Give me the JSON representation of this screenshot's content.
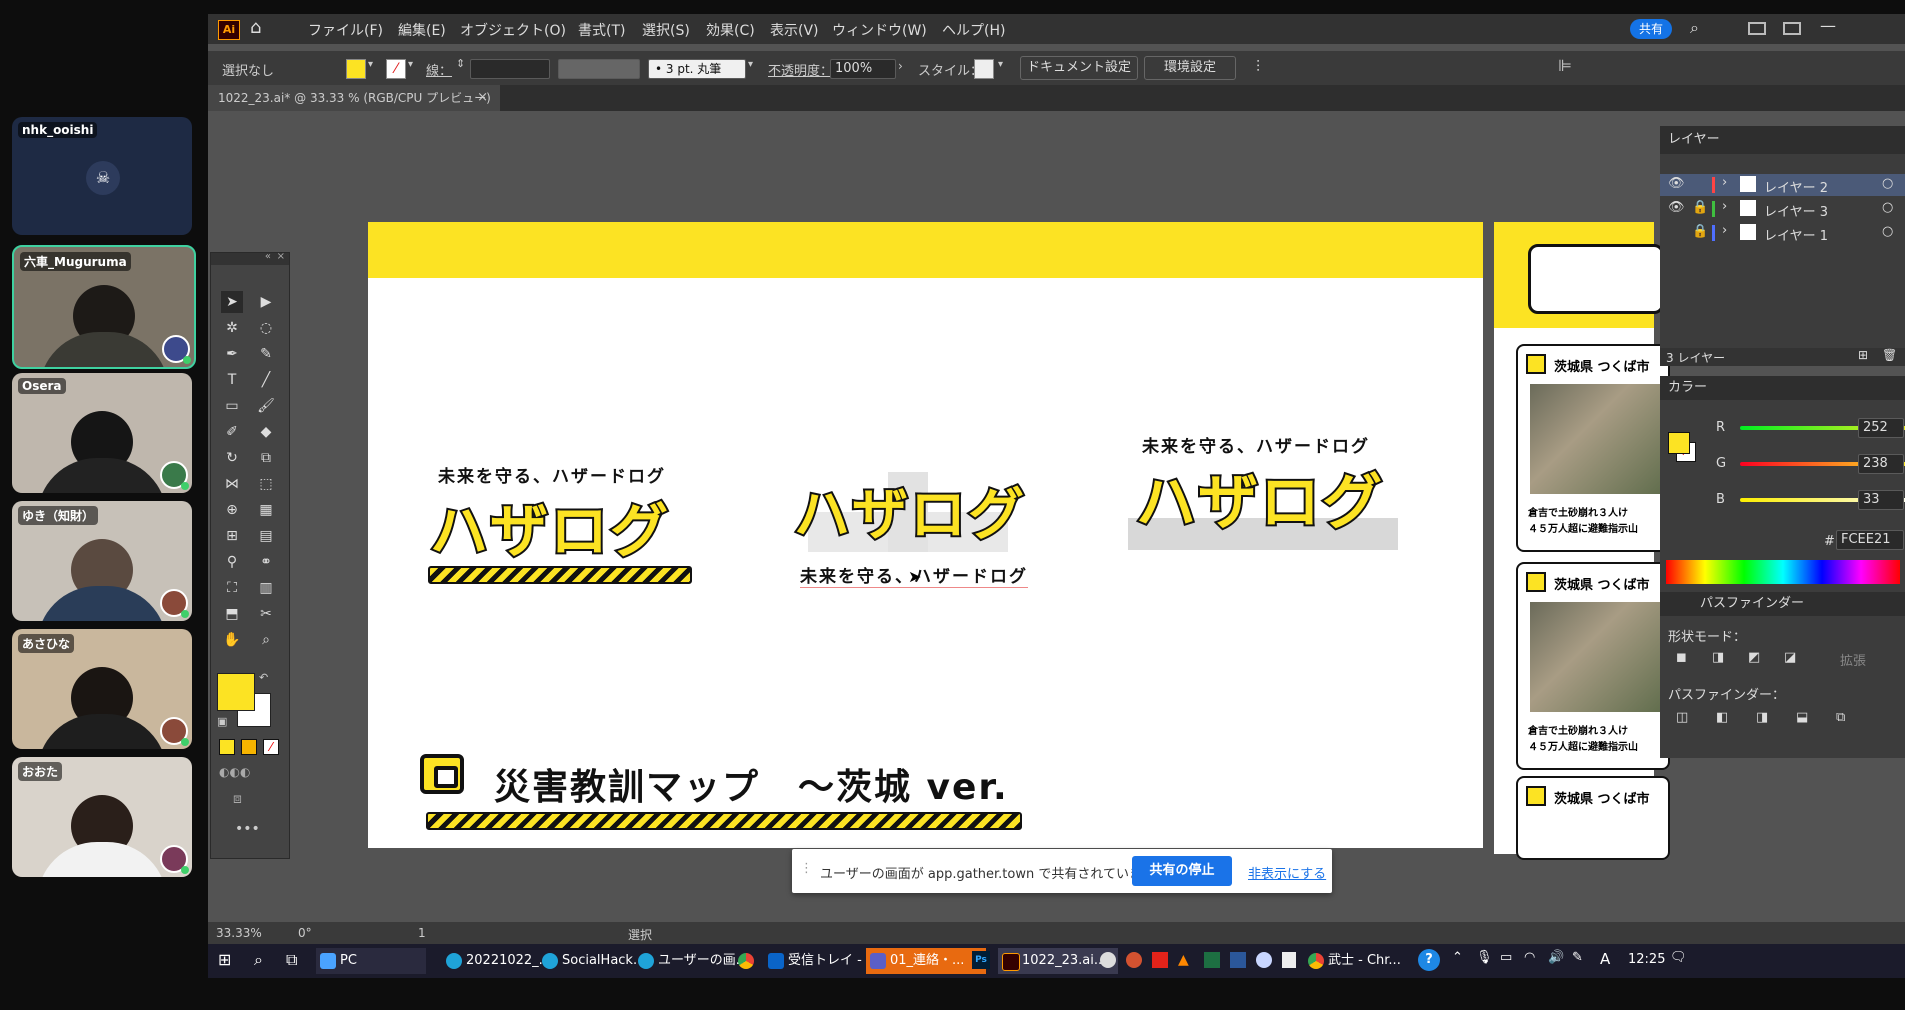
{
  "participants": [
    {
      "name": "nhk_ooishi",
      "camera_off": true
    },
    {
      "name": "六車_Muguruma"
    },
    {
      "name": "Osera"
    },
    {
      "name": "ゆき（知財）"
    },
    {
      "name": "あさひな"
    },
    {
      "name": "おおた"
    }
  ],
  "app": {
    "logo": "Ai",
    "menu": [
      "ファイル(F)",
      "編集(E)",
      "オブジェクト(O)",
      "書式(T)",
      "選択(S)",
      "効果(C)",
      "表示(V)",
      "ウィンドウ(W)",
      "ヘルプ(H)"
    ],
    "share_label": "共有"
  },
  "control_bar": {
    "selection": "選択なし",
    "stroke_label": "線：",
    "brush": "3 pt. 丸筆",
    "opacity_label": "不透明度：",
    "opacity_value": "100%",
    "style_label": "スタイル：",
    "doc_settings": "ドキュメント設定",
    "preferences": "環境設定"
  },
  "document_tab": {
    "title": "1022_23.ai* @ 33.33 % (RGB/CPU プレビュー)",
    "close": "×"
  },
  "artboard": {
    "tagline": "未来を守る、ハザードログ",
    "logo_text": "ハザロ",
    "logo_suffix": "グ",
    "map_title": "災害教訓マップ　～茨城 ver."
  },
  "right_artboard": {
    "cards": [
      {
        "title": "茨城県 つくば市",
        "caption1": "倉吉で土砂崩れ３人け",
        "caption2": "４５万人超に避難指示山"
      },
      {
        "title": "茨城県 つくば市",
        "caption1": "倉吉で土砂崩れ３人け",
        "caption2": "４５万人超に避難指示山"
      },
      {
        "title": "茨城県 つくば市"
      }
    ]
  },
  "layers_panel": {
    "title": "レイヤー",
    "layers": [
      {
        "name": "レイヤー 2",
        "color": "#ff4444",
        "selected": true
      },
      {
        "name": "レイヤー 3",
        "color": "#3fbf3f",
        "selected": false
      },
      {
        "name": "レイヤー 1",
        "color": "#4f6fff",
        "selected": false
      }
    ],
    "count": "3 レイヤー"
  },
  "color_panel": {
    "title": "カラー",
    "r_label": "R",
    "r": "252",
    "g_label": "G",
    "g": "238",
    "b_label": "B",
    "b": "33",
    "hex_label": "#",
    "hex": "FCEE21",
    "fill_color": "#FCEE21"
  },
  "pathfinder_panel": {
    "tab": "パスファインダー",
    "shape_modes": "形状モード：",
    "expand": "拡張",
    "pathfinders": "パスファインダー："
  },
  "status_bar": {
    "zoom": "33.33%",
    "rotation": "0°",
    "page": "1",
    "tool": "選択"
  },
  "share_notice": {
    "message": "ユーザーの画面が app.gather.town で共有されています。",
    "stop": "共有の停止",
    "hide": "非表示にする"
  },
  "taskbar": {
    "items": [
      "PC",
      "20221022_...",
      "SocialHack...",
      "ユーザーの画...",
      "受信トレイ - ...",
      "01_連絡・...",
      "1022_23.ai...",
      "武士 - Chr..."
    ],
    "time": "12:25",
    "ime": "A"
  }
}
